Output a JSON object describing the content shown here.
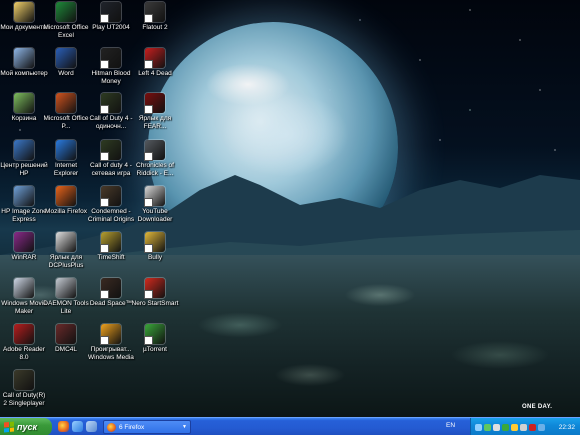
{
  "desktop": {
    "icons": [
      {
        "label": "Мои документы",
        "icon": "my-documents-icon",
        "color": "#f2d16b"
      },
      {
        "label": "Microsoft Office Excel",
        "icon": "excel-icon",
        "color": "#1f8a3a"
      },
      {
        "label": "Play UT2004",
        "icon": "ut2004-icon",
        "color": "#20242c"
      },
      {
        "label": "Flatout 2",
        "icon": "flatout2-icon",
        "color": "#3a3a3a"
      },
      {
        "label": "Мой компьютер",
        "icon": "my-computer-icon",
        "color": "#8fb7e8"
      },
      {
        "label": "Word",
        "icon": "word-icon",
        "color": "#2b5fb8"
      },
      {
        "label": "Hitman Blood Money",
        "icon": "hitman-icon",
        "color": "#222222"
      },
      {
        "label": "Left 4 Dead",
        "icon": "left4dead-icon",
        "color": "#c81f1f"
      },
      {
        "label": "Корзина",
        "icon": "recycle-bin-icon",
        "color": "#7fbf5f"
      },
      {
        "label": "Microsoft Office P...",
        "icon": "powerpoint-icon",
        "color": "#d2541f"
      },
      {
        "label": "Call of Duty 4 - одиночн...",
        "icon": "cod4-singleplayer-icon",
        "color": "#2e3b22"
      },
      {
        "label": "Ярлык для FEAR...",
        "icon": "fear-icon",
        "color": "#7a0e0e"
      },
      {
        "label": "Центр решений HP",
        "icon": "hp-solution-center-icon",
        "color": "#3b78c8"
      },
      {
        "label": "Internet Explorer",
        "icon": "internet-explorer-icon",
        "color": "#2a7be0"
      },
      {
        "label": "Call of duty 4 - сетевая игра",
        "icon": "cod4-multiplayer-icon",
        "color": "#2e3b22"
      },
      {
        "label": "Chronicles of Riddick - E...",
        "icon": "riddick-icon",
        "color": "#555a60"
      },
      {
        "label": "HP Image Zone Express",
        "icon": "hp-image-zone-icon",
        "color": "#6fa0d8"
      },
      {
        "label": "Mozilla Firefox",
        "icon": "firefox-icon",
        "color": "#e8641b"
      },
      {
        "label": "Condemned - Criminal Origins",
        "icon": "condemned-icon",
        "color": "#4a3a2a"
      },
      {
        "label": "YouTube Downloader",
        "icon": "youtube-downloader-icon",
        "color": "#d8d8d8"
      },
      {
        "label": "WinRAR",
        "icon": "winrar-icon",
        "color": "#8a2a8a"
      },
      {
        "label": "Ярлык для DCPlusPlus",
        "icon": "dcplusplus-icon",
        "color": "#e0e0e0"
      },
      {
        "label": "TimeShift",
        "icon": "timeshift-icon",
        "color": "#b8a030"
      },
      {
        "label": "Bully",
        "icon": "bully-icon",
        "color": "#e2b93a"
      },
      {
        "label": "Windows Movie Maker",
        "icon": "movie-maker-icon",
        "color": "#cfd8e6"
      },
      {
        "label": "DAEMON Tools Lite",
        "icon": "daemon-tools-icon",
        "color": "#c6ccd4"
      },
      {
        "label": "Dead Space™",
        "icon": "dead-space-icon",
        "color": "#3a2a22"
      },
      {
        "label": "Nero StartSmart",
        "icon": "nero-icon",
        "color": "#d22a1e"
      },
      {
        "label": "Adobe Reader 8.0",
        "icon": "adobe-reader-icon",
        "color": "#b81e1e"
      },
      {
        "label": "DMC4L",
        "icon": "dmc4-icon",
        "color": "#6a2a2a"
      },
      {
        "label": "Проигрыват... Windows Media",
        "icon": "windows-media-player-icon",
        "color": "#f0a21e"
      },
      {
        "label": "µTorrent",
        "icon": "utorrent-icon",
        "color": "#3aa83a"
      },
      {
        "label": "Call of Duty(R) 2 Singleplayer",
        "icon": "cod2-singleplayer-icon",
        "color": "#3b3a2a"
      }
    ]
  },
  "wallpaper": {
    "watermark": "ONE DAY."
  },
  "taskbar": {
    "start_label": "пуск",
    "task_label": "6 Firefox",
    "lang": "EN",
    "clock": "22:32"
  }
}
